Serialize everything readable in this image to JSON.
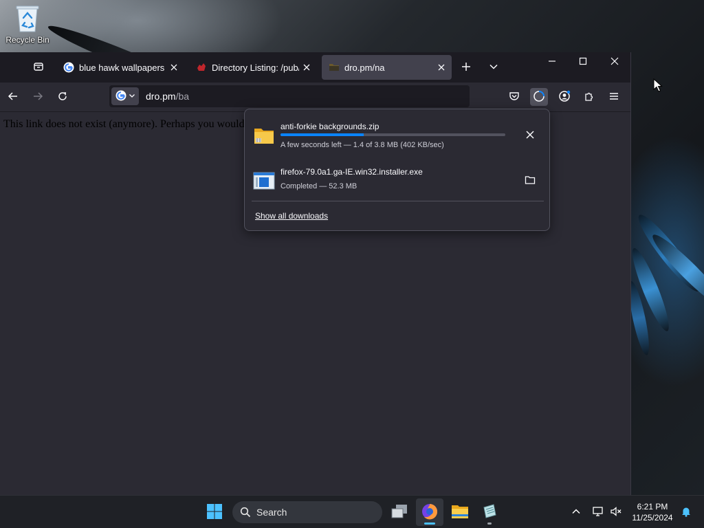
{
  "desktop": {
    "recycle_bin_label": "Recycle Bin"
  },
  "browser": {
    "tabs": [
      {
        "title": "blue hawk wallpapers - Go",
        "favicon": "google-icon",
        "active": false
      },
      {
        "title": "Directory Listing: /pub/fire",
        "favicon": "archive-red-icon",
        "active": false
      },
      {
        "title": "dro.pm/na",
        "favicon": "folder-dark-icon",
        "active": true
      }
    ],
    "url": {
      "host": "dro.pm",
      "path": "/ba"
    },
    "page_text": "This link does not exist (anymore). Perhaps you would",
    "accent_color": "#0a84ff"
  },
  "downloads": {
    "items": [
      {
        "filename": "anti-forkie backgrounds.zip",
        "status": "A few seconds left — 1.4 of 3.8 MB (402 KB/sec)",
        "progress": 0.37,
        "icon": "zip-folder-icon",
        "action": "cancel"
      },
      {
        "filename": "firefox-79.0a1.ga-IE.win32.installer.exe",
        "status": "Completed — 52.3 MB",
        "icon": "installer-icon",
        "action": "open-folder"
      }
    ],
    "show_all_label": "Show all downloads"
  },
  "taskbar": {
    "search_label": "Search",
    "clock": {
      "time": "6:21 PM",
      "date": "11/25/2024"
    }
  }
}
